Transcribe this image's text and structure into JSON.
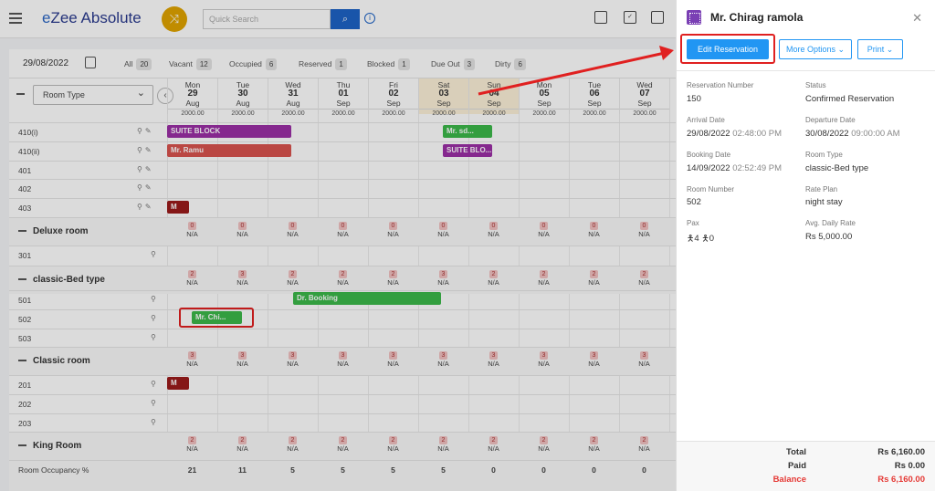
{
  "app": {
    "title_prefix": "e",
    "title": "Zee Absolute",
    "search_placeholder": "Quick Search"
  },
  "filters": {
    "date": "29/08/2022",
    "items": [
      {
        "label": "All",
        "count": "20"
      },
      {
        "label": "Vacant",
        "count": "12"
      },
      {
        "label": "Occupied",
        "count": "6"
      },
      {
        "label": "Reserved",
        "count": "1"
      },
      {
        "label": "Blocked",
        "count": "1"
      },
      {
        "label": "Due Out",
        "count": "3"
      },
      {
        "label": "Dirty",
        "count": "6"
      }
    ]
  },
  "grid": {
    "room_type_select": "Room Type",
    "days": [
      {
        "dow": "Mon",
        "num": "29",
        "mon": "Aug",
        "rate": "2000.00"
      },
      {
        "dow": "Tue",
        "num": "30",
        "mon": "Aug",
        "rate": "2000.00"
      },
      {
        "dow": "Wed",
        "num": "31",
        "mon": "Aug",
        "rate": "2000.00"
      },
      {
        "dow": "Thu",
        "num": "01",
        "mon": "Sep",
        "rate": "2000.00"
      },
      {
        "dow": "Fri",
        "num": "02",
        "mon": "Sep",
        "rate": "2000.00"
      },
      {
        "dow": "Sat",
        "num": "03",
        "mon": "Sep",
        "rate": "2000.00"
      },
      {
        "dow": "Sun",
        "num": "04",
        "mon": "Sep",
        "rate": "2000.00"
      },
      {
        "dow": "Mon",
        "num": "05",
        "mon": "Sep",
        "rate": "2000.00"
      },
      {
        "dow": "Tue",
        "num": "06",
        "mon": "Sep",
        "rate": "2000.00"
      },
      {
        "dow": "Wed",
        "num": "07",
        "mon": "Sep",
        "rate": "2000.00"
      }
    ],
    "rooms_top": [
      "410(i)",
      "410(ii)",
      "401",
      "402",
      "403"
    ],
    "groups": [
      {
        "name": "Deluxe room",
        "counts": [
          "0",
          "0",
          "0",
          "0",
          "0",
          "0",
          "0",
          "0",
          "0",
          "0"
        ],
        "rooms": [
          "301"
        ]
      },
      {
        "name": "classic-Bed type",
        "counts": [
          "2",
          "3",
          "2",
          "2",
          "2",
          "3",
          "2",
          "2",
          "2",
          "2"
        ],
        "rooms": [
          "501",
          "502",
          "503"
        ]
      },
      {
        "name": "Classic room",
        "counts": [
          "3",
          "3",
          "3",
          "3",
          "3",
          "3",
          "3",
          "3",
          "3",
          "3"
        ],
        "rooms": [
          "201",
          "202",
          "203"
        ]
      },
      {
        "name": "King Room",
        "counts": [
          "2",
          "2",
          "2",
          "2",
          "2",
          "2",
          "2",
          "2",
          "2",
          "2"
        ],
        "rooms": []
      }
    ],
    "na": "N/A",
    "bookings": {
      "suite_block_1": "SUITE BLOCK",
      "mr_ramu": "Mr. Ramu",
      "mr_sd": "Mr. sd...",
      "suite_block_2": "SUITE BLO...",
      "dr_booking": "Dr. Booking",
      "mr_chi": "Mr. Chi...",
      "m1": "M",
      "m2": "M"
    },
    "occupancy_label": "Room Occupancy %",
    "occupancy": [
      "21",
      "11",
      "5",
      "5",
      "5",
      "5",
      "0",
      "0",
      "0",
      "0"
    ]
  },
  "panel": {
    "title": "Mr. Chirag ramola",
    "edit_btn": "Edit Reservation",
    "more_btn": "More Options",
    "print_btn": "Print",
    "fields": {
      "res_no_label": "Reservation Number",
      "res_no": "150",
      "status_label": "Status",
      "status": "Confirmed Reservation",
      "arrival_label": "Arrival Date",
      "arrival_date": "29/08/2022",
      "arrival_time": "02:48:00 PM",
      "departure_label": "Departure Date",
      "departure_date": "30/08/2022",
      "departure_time": "09:00:00 AM",
      "booking_label": "Booking Date",
      "booking_date": "14/09/2022",
      "booking_time": "02:52:49 PM",
      "roomtype_label": "Room Type",
      "roomtype": "classic-Bed type",
      "roomno_label": "Room Number",
      "roomno": "502",
      "rateplan_label": "Rate Plan",
      "rateplan": "night stay",
      "pax_label": "Pax",
      "adults": "4",
      "children": "0",
      "adr_label": "Avg. Daily Rate",
      "adr": "Rs 5,000.00"
    },
    "totals": {
      "total_label": "Total",
      "total": "Rs 6,160.00",
      "paid_label": "Paid",
      "paid": "Rs 0.00",
      "balance_label": "Balance",
      "balance": "Rs 6,160.00"
    }
  },
  "colors": {
    "accent": "#2196f3",
    "highlight": "#e02020",
    "booking_green": "#3cb94a",
    "booking_purple": "#9b2fa6",
    "booking_red": "#d9534f"
  }
}
